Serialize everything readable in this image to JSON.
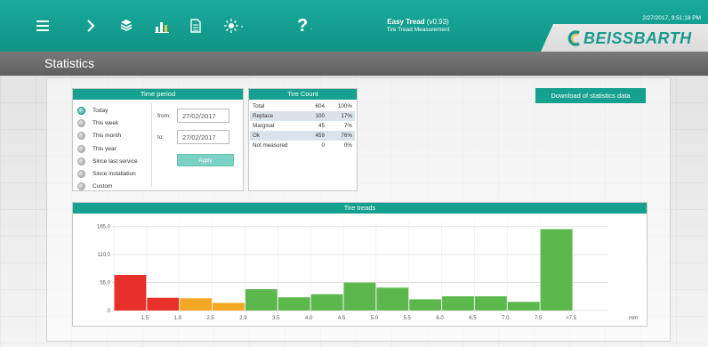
{
  "header": {
    "app_name": "Easy Tread",
    "version": "(v0.93)",
    "subtitle": "Tire Tread Measurement",
    "datetime": "2/27/2017, 9:51:18 PM",
    "logo_text": "BEISSBARTH",
    "accent_color": "#16a08f"
  },
  "toolbar": {
    "icons": [
      "menu-icon",
      "chevron-right-icon",
      "layers-icon",
      "statistics-icon",
      "document-icon",
      "brightness-icon",
      "help-icon"
    ],
    "help_label": "?"
  },
  "page": {
    "title": "Statistics"
  },
  "time_period": {
    "title": "Time period",
    "options": [
      {
        "label": "Today",
        "selected": true
      },
      {
        "label": "This week",
        "selected": false
      },
      {
        "label": "This month",
        "selected": false
      },
      {
        "label": "This year",
        "selected": false
      },
      {
        "label": "Since last service",
        "selected": false
      },
      {
        "label": "Since installation",
        "selected": false
      },
      {
        "label": "Custom",
        "selected": false
      }
    ],
    "from_label": "from:",
    "to_label": "to:",
    "from_value": "27/02/2017",
    "to_value": "27/02/2017",
    "apply_label": "Apply"
  },
  "tire_count": {
    "title": "Tire Count",
    "rows": [
      {
        "label": "Total",
        "count": "604",
        "pct": "100%"
      },
      {
        "label": "Replace",
        "count": "100",
        "pct": "17%"
      },
      {
        "label": "Marginal",
        "count": "45",
        "pct": "7%"
      },
      {
        "label": "Ok",
        "count": "459",
        "pct": "76%"
      },
      {
        "label": "Not measured",
        "count": "0",
        "pct": "0%"
      }
    ]
  },
  "download": {
    "label": "Download of statistics data"
  },
  "chart_data": {
    "type": "bar",
    "title": "Tire treads",
    "xlabel": "mm",
    "x_ticks": [
      "1.5",
      "1.9",
      "2.5",
      "2.9",
      "3.5",
      "4.0",
      "4.5",
      "5.0",
      "5.5",
      "6.0",
      "6.5",
      "7.0",
      "7.5",
      ">7.5"
    ],
    "y_ticks": [
      "0",
      "55.0",
      "110.0",
      "165.0"
    ],
    "ylim": [
      0,
      175
    ],
    "values": [
      70,
      25,
      24,
      15,
      42,
      26,
      32,
      55,
      45,
      22,
      28,
      28,
      17,
      160
    ],
    "colors": [
      "#e8302a",
      "#e8302a",
      "#f5a623",
      "#f5a623",
      "#5cb84c",
      "#5cb84c",
      "#5cb84c",
      "#5cb84c",
      "#5cb84c",
      "#5cb84c",
      "#5cb84c",
      "#5cb84c",
      "#5cb84c",
      "#5cb84c"
    ],
    "grid": true
  }
}
